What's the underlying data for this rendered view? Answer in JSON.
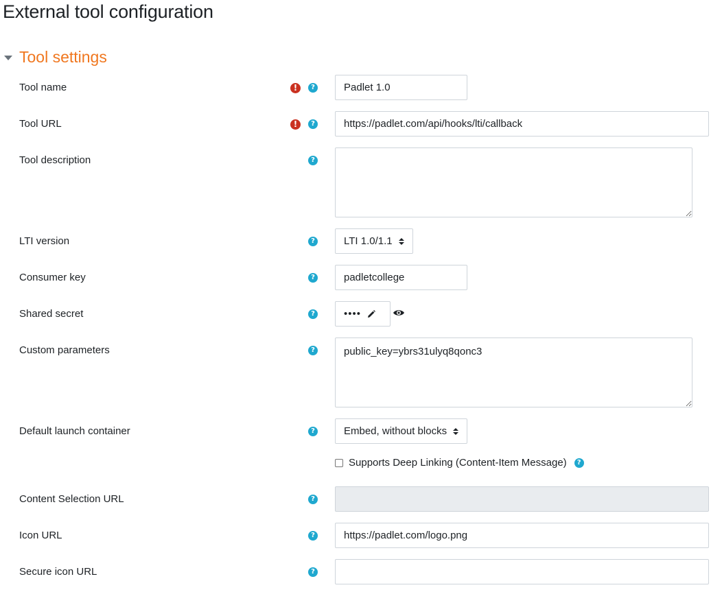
{
  "page": {
    "title": "External tool configuration"
  },
  "section": {
    "title": "Tool settings"
  },
  "fields": {
    "tool_name": {
      "label": "Tool name",
      "value": "Padlet 1.0"
    },
    "tool_url": {
      "label": "Tool URL",
      "value": "https://padlet.com/api/hooks/lti/callback"
    },
    "tool_description": {
      "label": "Tool description",
      "value": ""
    },
    "lti_version": {
      "label": "LTI version",
      "selected": "LTI 1.0/1.1"
    },
    "consumer_key": {
      "label": "Consumer key",
      "value": "padletcollege"
    },
    "shared_secret": {
      "label": "Shared secret",
      "masked": "••••"
    },
    "custom_parameters": {
      "label": "Custom parameters",
      "value": "public_key=ybrs31ulyq8qonc3"
    },
    "default_launch_container": {
      "label": "Default launch container",
      "selected": "Embed, without blocks"
    },
    "deep_linking": {
      "label": "Supports Deep Linking (Content-Item Message)",
      "checked": false
    },
    "content_selection_url": {
      "label": "Content Selection URL",
      "value": ""
    },
    "icon_url": {
      "label": "Icon URL",
      "value": "https://padlet.com/logo.png"
    },
    "secure_icon_url": {
      "label": "Secure icon URL",
      "value": ""
    }
  },
  "icons": {
    "required": "exclamation-circle-icon",
    "help": "question-circle-icon",
    "edit": "pencil-icon",
    "reveal": "eye-icon"
  },
  "colors": {
    "section_title": "#f0771f",
    "required_icon": "#ca3120",
    "help_icon": "#1fa8cf",
    "disabled_field": "#e9ecef"
  }
}
